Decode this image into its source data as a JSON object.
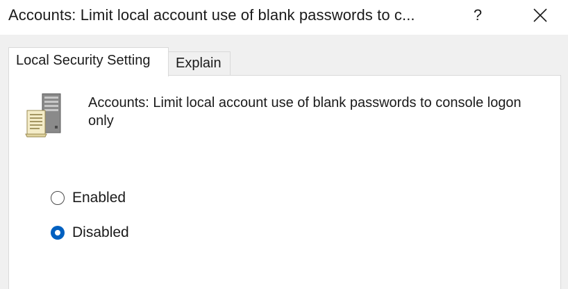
{
  "window": {
    "title": "Accounts: Limit local account use of blank passwords to c...",
    "help_label": "?"
  },
  "tabs": [
    {
      "label": "Local Security Setting",
      "selected": true
    },
    {
      "label": "Explain",
      "selected": false
    }
  ],
  "policy": {
    "icon": "server-document-icon",
    "title": "Accounts: Limit local account use of blank passwords to console logon only"
  },
  "options": [
    {
      "label": "Enabled",
      "checked": false
    },
    {
      "label": "Disabled",
      "checked": true
    }
  ],
  "colors": {
    "accent": "#0060c0",
    "panel_background": "#ffffff",
    "window_background": "#f0f0f0"
  }
}
